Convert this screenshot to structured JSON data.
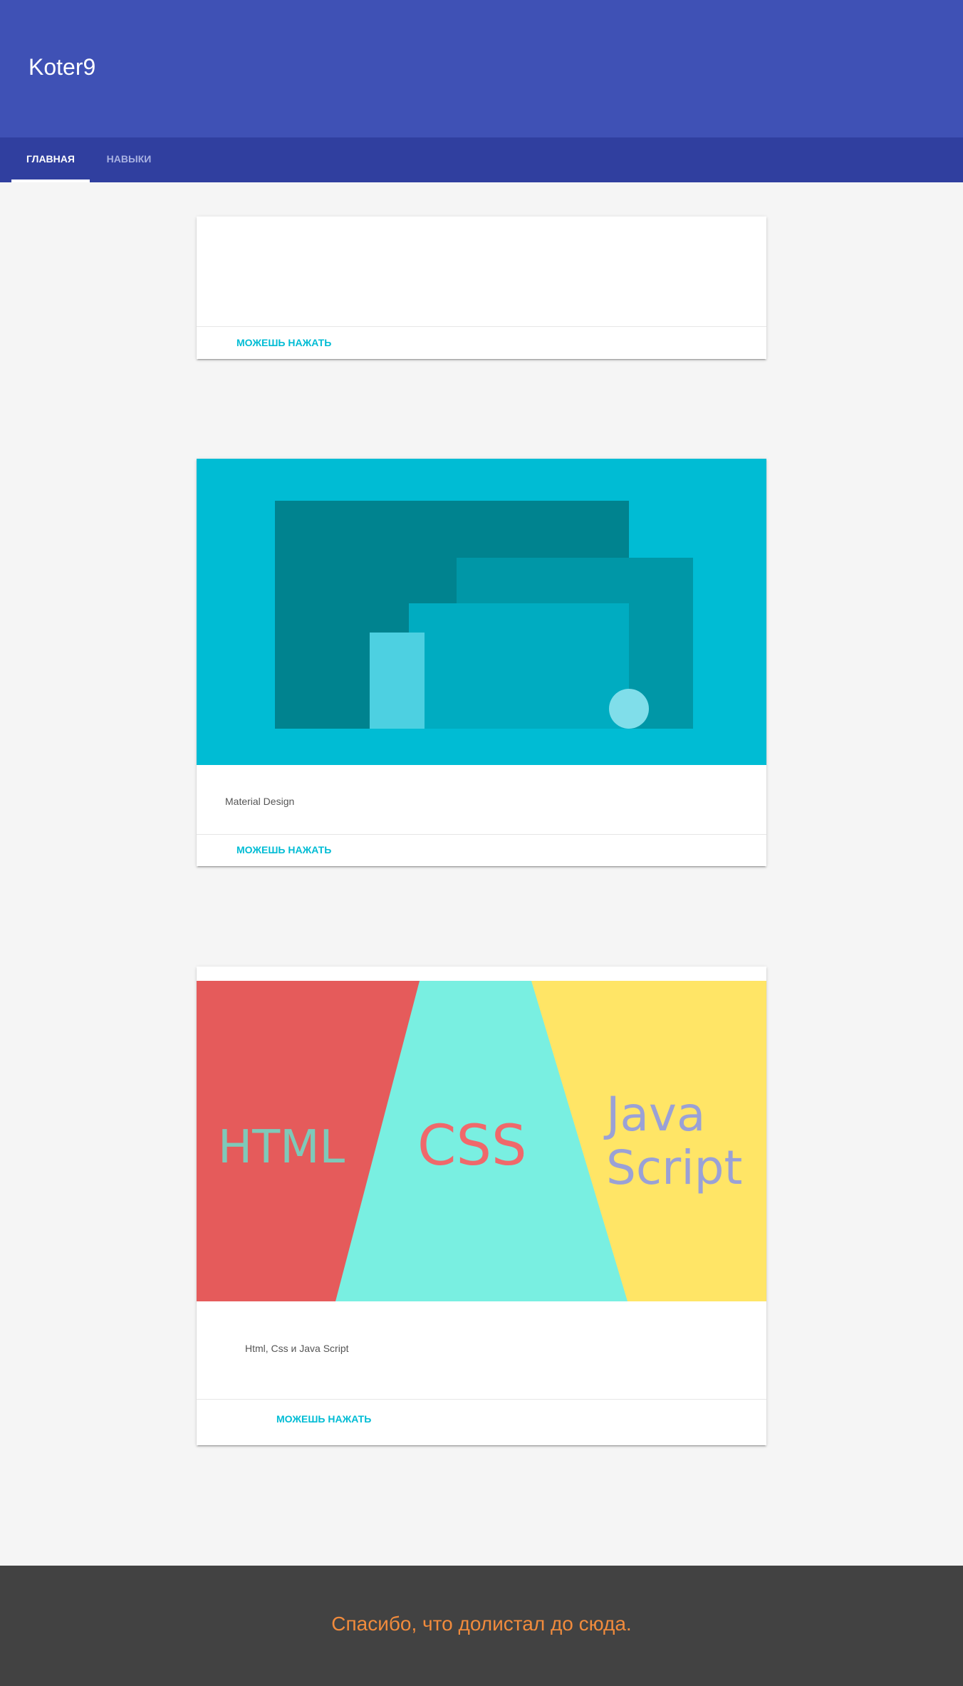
{
  "header": {
    "title": "Koter9",
    "tabs": [
      {
        "label": "Главная",
        "active": true
      },
      {
        "label": "Навыки",
        "active": false
      }
    ]
  },
  "cards": [
    {
      "text": "",
      "action": "Можешь нажать"
    },
    {
      "text": "Material Design",
      "action": "Можешь нажать",
      "image": {
        "type": "illustration",
        "subject": "material-design"
      }
    },
    {
      "text": "Html, Css и Java Script",
      "action": "Можешь нажать",
      "image": {
        "words": {
          "html": "HTML",
          "css": "CSS",
          "js_line1": "Java",
          "js_line2": "Script"
        }
      }
    }
  ],
  "footer": {
    "text": "Спасибо, что долистал до сюда."
  },
  "colors": {
    "primary": "#3f51b5",
    "primary_dark": "#303f9f",
    "accent": "#00bcd4",
    "background": "#f5f5f5",
    "footer_bg": "#424242",
    "footer_text": "#f18b3c",
    "html_panel": "#e55b5b",
    "css_panel": "#79efe1",
    "js_panel": "#ffe566"
  }
}
